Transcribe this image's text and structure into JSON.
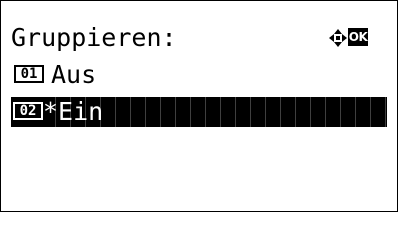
{
  "panel": {
    "title": "Gruppieren:",
    "ok_label": "OK"
  },
  "options": [
    {
      "number": "01",
      "label": "Aus",
      "selected": false
    },
    {
      "number": "02",
      "label": "*Ein",
      "selected": true
    }
  ],
  "icons": {
    "nav": "four-way-arrow-icon",
    "ok": "ok-button-icon"
  },
  "colors": {
    "background": "#ffffff",
    "foreground": "#000000",
    "highlight": "#000000"
  }
}
